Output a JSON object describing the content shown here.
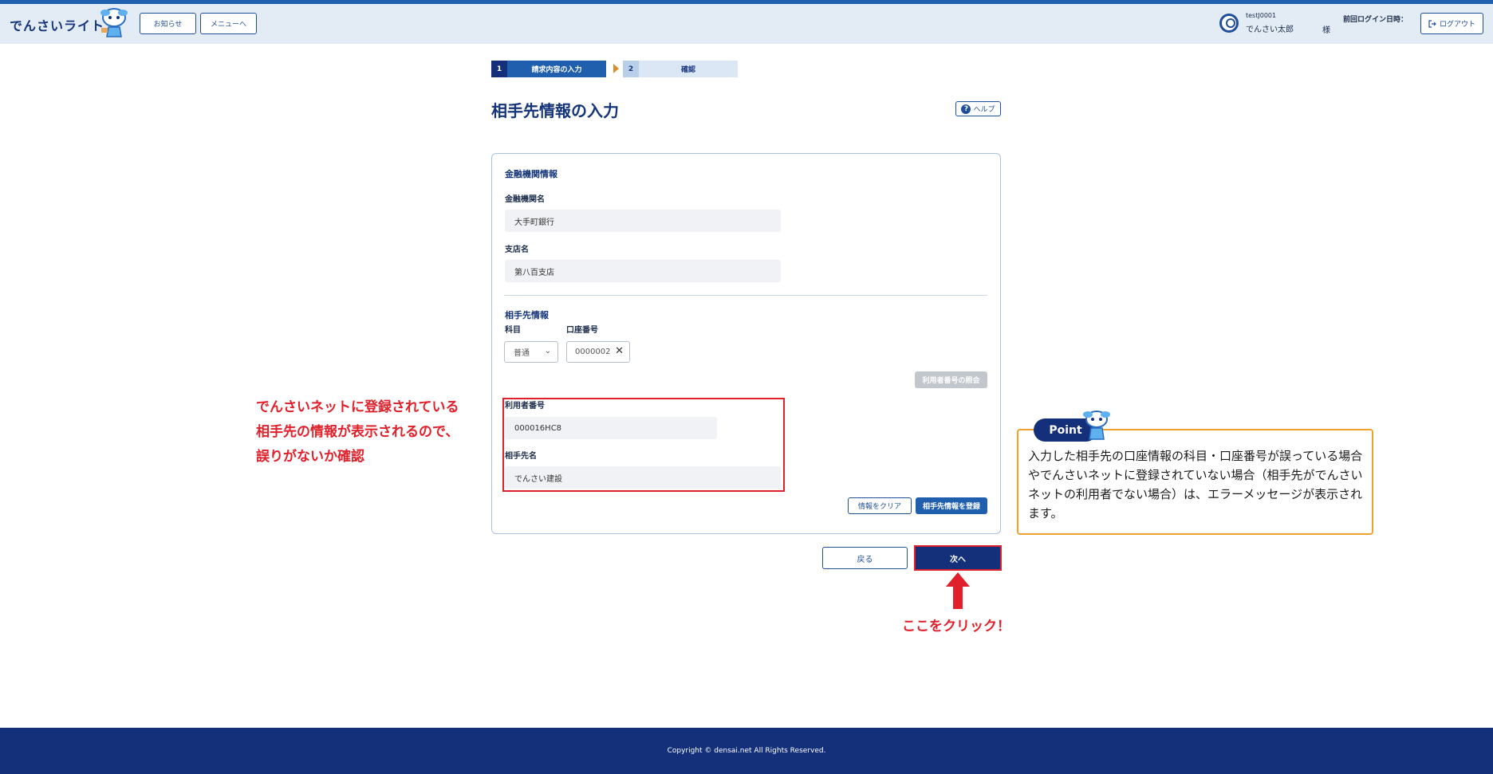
{
  "header": {
    "app_name": "でんさいライト",
    "notice_label": "お知らせ",
    "menu_label": "メニューへ",
    "user_id": "testJ0001",
    "user_name": "でんさい太郎",
    "honorific": "様",
    "last_login_label": "前回ログイン日時：",
    "logout_label": "ログアウト"
  },
  "steps": [
    {
      "num": "1",
      "label": "請求内容の入力"
    },
    {
      "num": "2",
      "label": "確認"
    }
  ],
  "page": {
    "title": "相手先情報の入力",
    "help_label": "ヘルプ"
  },
  "bank_section": {
    "title": "金融機関情報",
    "bank_label": "金融機関名",
    "bank_value": "大手町銀行",
    "branch_label": "支店名",
    "branch_value": "第八百支店"
  },
  "partner_section": {
    "title": "相手先情報",
    "subject_label": "科目",
    "subject_value": "普通",
    "account_label": "口座番号",
    "account_value": "0000002",
    "inquiry_label": "利用者番号の照会",
    "user_no_label": "利用者番号",
    "user_no_value": "000016HC8",
    "partner_name_label": "相手先名",
    "partner_name_value": "でんさい建設",
    "clear_label": "情報をクリア",
    "register_label": "相手先情報を登録"
  },
  "actions": {
    "back_label": "戻る",
    "next_label": "次へ"
  },
  "annotations": {
    "left_note": [
      "でんさいネットに登録されている",
      "相手先の情報が表示されるので、",
      "誤りがないか確認"
    ],
    "click_here": "ここをクリック！",
    "point_label": "Point",
    "point_text": "入力した相手先の口座情報の科目・口座番号が誤っている場合やでんさいネットに登録されていない場合（相手先がでんさいネットの利用者でない場合）は、エラーメッセージが表示されます。"
  },
  "footer": {
    "copyright": "Copyright © densai.net All Rights Reserved."
  },
  "colors": {
    "brand_navy": "#14307a",
    "accent_blue": "#1f5fae",
    "highlight_red": "#e0202a",
    "point_orange": "#f0a12e"
  }
}
